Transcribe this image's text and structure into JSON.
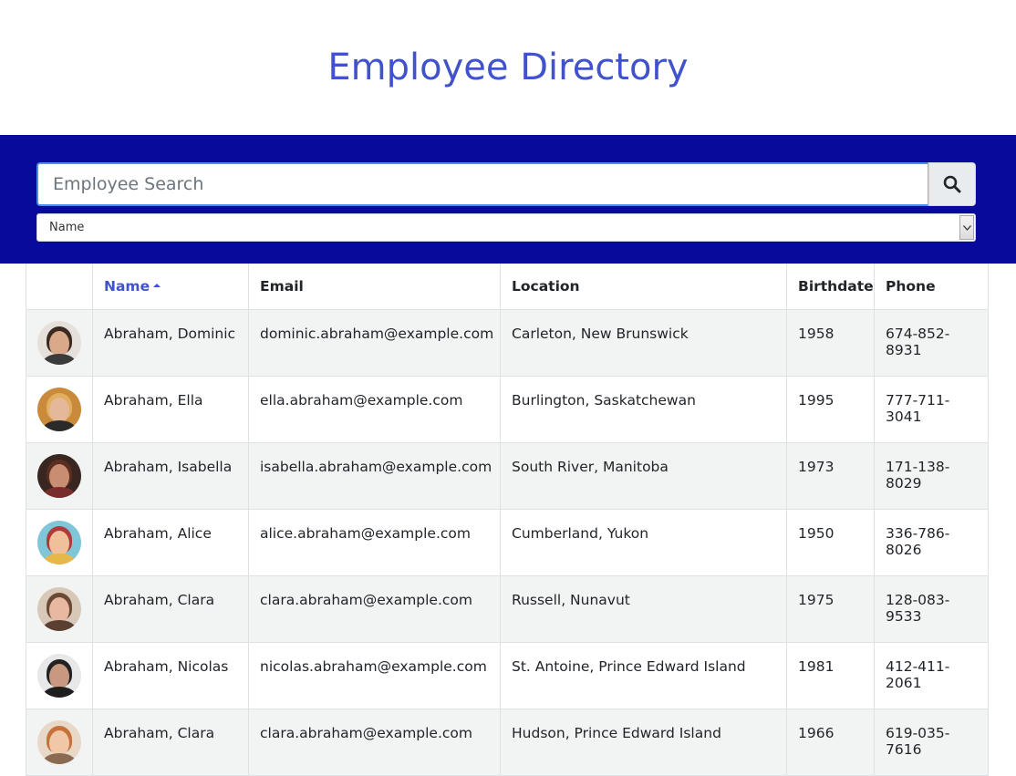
{
  "title": "Employee Directory",
  "search": {
    "placeholder": "Employee Search",
    "button_icon": "search-icon"
  },
  "sort_select": {
    "selected": "Name"
  },
  "table": {
    "columns": [
      "",
      "Name",
      "Email",
      "Location",
      "Birthdate",
      "Phone"
    ],
    "sorted_column": "Name",
    "sort_direction": "ascending",
    "rows": [
      {
        "name": "Abraham, Dominic",
        "email": "dominic.abraham@example.com",
        "location": "Carleton, New Brunswick",
        "birthdate": "1958",
        "phone": "674-852-8931",
        "avatar": {
          "bg": "#e6e0da",
          "hair": "#3a2a20",
          "skin": "#d9a98a",
          "shirt": "#3b3b3b"
        }
      },
      {
        "name": "Abraham, Ella",
        "email": "ella.abraham@example.com",
        "location": "Burlington, Saskatchewan",
        "birthdate": "1995",
        "phone": "777-711-3041",
        "avatar": {
          "bg": "#c98a3c",
          "hair": "#e0b060",
          "skin": "#e6b89a",
          "shirt": "#2a2a2a"
        }
      },
      {
        "name": "Abraham, Isabella",
        "email": "isabella.abraham@example.com",
        "location": "South River, Manitoba",
        "birthdate": "1973",
        "phone": "171-138-8029",
        "avatar": {
          "bg": "#3a2620",
          "hair": "#5a2e20",
          "skin": "#c98e72",
          "shirt": "#7a2c2c"
        }
      },
      {
        "name": "Abraham, Alice",
        "email": "alice.abraham@example.com",
        "location": "Cumberland, Yukon",
        "birthdate": "1950",
        "phone": "336-786-8026",
        "avatar": {
          "bg": "#7ec6d8",
          "hair": "#b03a3a",
          "skin": "#f0c09a",
          "shirt": "#e6b84a"
        }
      },
      {
        "name": "Abraham, Clara",
        "email": "clara.abraham@example.com",
        "location": "Russell, Nunavut",
        "birthdate": "1975",
        "phone": "128-083-9533",
        "avatar": {
          "bg": "#d8c8b8",
          "hair": "#6a4a34",
          "skin": "#e8b8a0",
          "shirt": "#5a4030"
        }
      },
      {
        "name": "Abraham, Nicolas",
        "email": "nicolas.abraham@example.com",
        "location": "St. Antoine, Prince Edward Island",
        "birthdate": "1981",
        "phone": "412-411-2061",
        "avatar": {
          "bg": "#e8e8e8",
          "hair": "#222222",
          "skin": "#c89880",
          "shirt": "#1e1e1e"
        }
      },
      {
        "name": "Abraham, Clara",
        "email": "clara.abraham@example.com",
        "location": "Hudson, Prince Edward Island",
        "birthdate": "1966",
        "phone": "619-035-7616",
        "avatar": {
          "bg": "#e8d8c8",
          "hair": "#c8703a",
          "skin": "#f0c8a8",
          "shirt": "#8a6a50"
        }
      }
    ]
  },
  "colors": {
    "title": "#4052cc",
    "search_band": "#070a9b",
    "sorted_header": "#4052cc",
    "striped_row": "#f2f3f3"
  }
}
